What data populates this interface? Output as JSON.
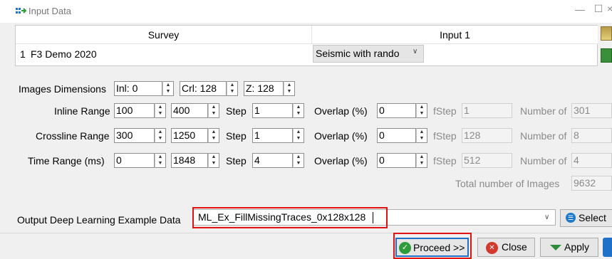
{
  "window": {
    "title": "Input Data",
    "minimize_label": "—",
    "maximize_label": "☐",
    "close_label": "×"
  },
  "table": {
    "headers": [
      "Survey",
      "Input 1"
    ],
    "rows": [
      {
        "num": "1",
        "survey": "F3 Demo 2020",
        "input": "Seismic with rando"
      }
    ]
  },
  "image_dimensions": {
    "label": "Images Dimensions",
    "inl": "Inl: 0",
    "crl": "Crl: 128",
    "z": "Z: 128"
  },
  "ranges": [
    {
      "label": "Inline Range",
      "start": "100",
      "stop": "400",
      "step_label": "Step",
      "step": "1",
      "overlap_label": "Overlap (%)",
      "overlap": "0",
      "fstep_label": "fStep",
      "fstep": "1",
      "number_label": "Number of",
      "number": "301"
    },
    {
      "label": "Crossline Range",
      "start": "300",
      "stop": "1250",
      "step_label": "Step",
      "step": "1",
      "overlap_label": "Overlap (%)",
      "overlap": "0",
      "fstep_label": "fStep",
      "fstep": "128",
      "number_label": "Number of",
      "number": "8"
    },
    {
      "label": "Time Range (ms)",
      "start": "0",
      "stop": "1848",
      "step_label": "Step",
      "step": "4",
      "overlap_label": "Overlap (%)",
      "overlap": "0",
      "fstep_label": "fStep",
      "fstep": "512",
      "number_label": "Number of",
      "number": "4"
    }
  ],
  "total": {
    "label": "Total number of Images",
    "value": "9632"
  },
  "output": {
    "label": "Output Deep Learning Example Data",
    "value": "ML_Ex_FillMissingTraces_0x128x128",
    "select_label": "Select"
  },
  "buttons": {
    "proceed": "Proceed >>",
    "close": "Close",
    "apply": "Apply"
  },
  "icons": {
    "proceed": "check-circle-icon",
    "close": "x-circle-icon",
    "apply": "down-triangle-icon",
    "select": "list-icon",
    "help": "help-icon"
  }
}
